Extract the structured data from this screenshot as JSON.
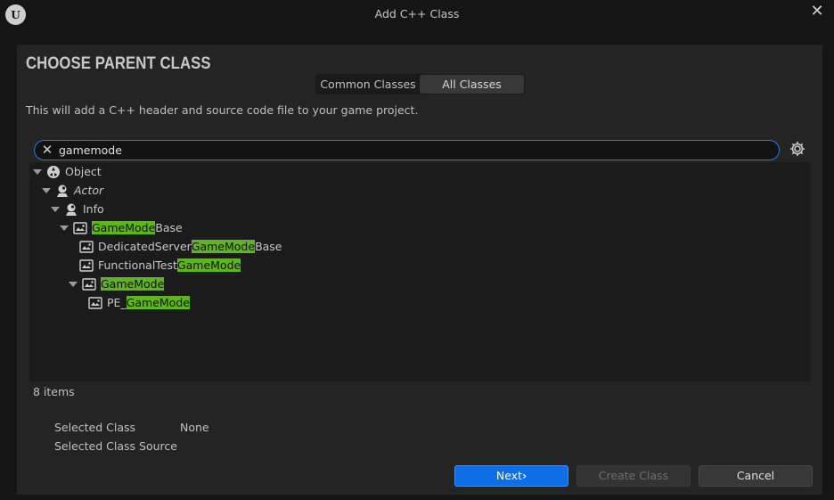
{
  "window": {
    "title": "Add C++ Class",
    "logo_text": "U"
  },
  "header": {
    "heading": "CHOOSE PARENT CLASS",
    "subtitle": "This will add a C++ header and source code file to your game project."
  },
  "tabs": [
    {
      "label": "Common Classes",
      "selected": false
    },
    {
      "label": "All Classes",
      "selected": true
    }
  ],
  "search": {
    "value": "gamemode",
    "placeholder": ""
  },
  "tree": [
    {
      "label_pre": "",
      "label_hl": "",
      "label_post": "Object",
      "italic": false
    },
    {
      "label_pre": "",
      "label_hl": "",
      "label_post": "Actor",
      "italic": true
    },
    {
      "label_pre": "",
      "label_hl": "",
      "label_post": "Info",
      "italic": false
    },
    {
      "label_pre": "",
      "label_hl": "GameMode",
      "label_post": "Base",
      "italic": false
    },
    {
      "label_pre": "DedicatedServer",
      "label_hl": "GameMode",
      "label_post": "Base",
      "italic": false
    },
    {
      "label_pre": "FunctionalTest",
      "label_hl": "GameMode",
      "label_post": "",
      "italic": false
    },
    {
      "label_pre": "",
      "label_hl": "GameMode",
      "label_post": "",
      "italic": false
    },
    {
      "label_pre": "PE_",
      "label_hl": "GameMode",
      "label_post": "",
      "italic": false
    }
  ],
  "status": {
    "count": "8 items"
  },
  "details": {
    "selected_class_label": "Selected Class",
    "selected_class_value": "None",
    "selected_class_source_label": "Selected Class Source",
    "selected_class_source_value": ""
  },
  "buttons": {
    "next": "Next",
    "create": "Create Class",
    "cancel": "Cancel"
  },
  "colors": {
    "accent": "#0e6ee6",
    "highlight": "#5fb51e",
    "search_border": "#2a7bd6"
  }
}
